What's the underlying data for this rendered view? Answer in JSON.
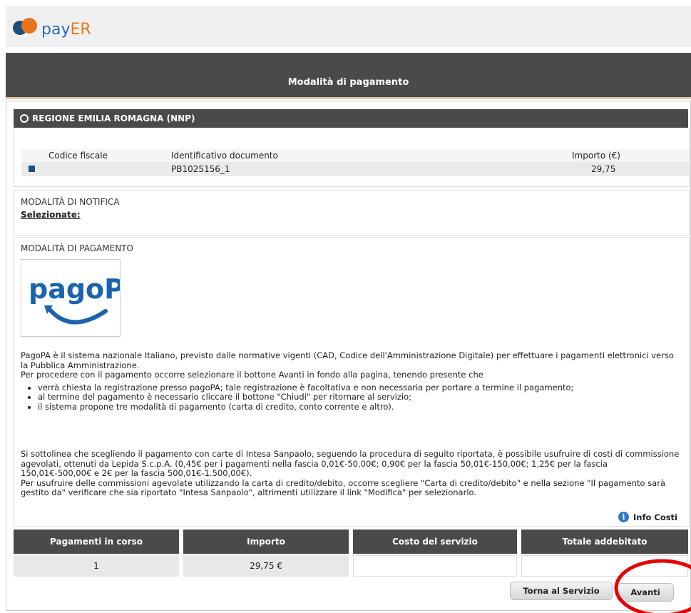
{
  "header": {
    "logo_text_1": "pay",
    "logo_text_2": "ER",
    "page_title": "Modalità di pagamento"
  },
  "ente": {
    "name": "REGIONE EMILIA ROMAGNA (NNP)"
  },
  "documents_table": {
    "columns": [
      "Codice fiscale",
      "Identificativo documento",
      "Importo (€)"
    ],
    "rows": [
      {
        "codice_fiscale": "",
        "identificativo": "PB1025156_1",
        "importo": "29,75"
      }
    ]
  },
  "notifica": {
    "heading": "MODALITÀ DI NOTIFICA",
    "selected_label": "Selezionate:"
  },
  "pagamento": {
    "heading": "MODALITÀ DI PAGAMENTO",
    "logo_text": "pagoPA",
    "intro_1": "PagoPA è il sistema nazionale Italiano, previsto dalle normative vigenti (CAD, Codice dell'Amministrazione Digitale) per effettuare i pagamenti elettronici verso la Pubblica Amministrazione.",
    "intro_2": "Per procedere con il pagamento occorre selezionare il bottone Avanti in fondo alla pagina, tenendo presente che",
    "bullets": [
      "verrà chiesta la registrazione presso pagoPA; tale registrazione è facoltativa e non necessaria per portare a termine il pagamento;",
      "al termine del pagamento è necessario cliccare il bottone \"Chiudi\" per ritornare al servizio;",
      "il sistema propone tre modalità di pagamento (carta di credito, conto corrente e altro)."
    ],
    "note_1": "Si sottolinea che scegliendo il pagamento con carte di Intesa Sanpaolo, seguendo la procedura di seguito riportata, è possibile usufruire di costi di commissione agevolati, ottenuti da Lepida S.c.p.A. (0,45€ per i pagamenti nella fascia 0,01€-50,00€; 0,90€ per la fascia 50,01€-150,00€; 1,25€ per la fascia 150,01€-500,00€ e 2€ per la fascia 500,01€-1.500,00€).",
    "note_2": "Per usufruire delle commissioni agevolate utilizzando la carta di credito/debito, occorre scegliere \"Carta di credito/debito\" e nella sezione \"Il pagamento sarà gestito da\" verificare che sia riportato \"Intesa Sanpaolo\", altrimenti utilizzare il link \"Modifica\" per selezionarlo.",
    "info_costi": "Info Costi"
  },
  "summary": {
    "headers": [
      "Pagamenti in corso",
      "Importo",
      "Costo del servizio",
      "Totale addebitato"
    ],
    "values": [
      "1",
      "29,75 €",
      "",
      ""
    ]
  },
  "actions": {
    "torna": "Torna al Servizio",
    "avanti": "Avanti"
  }
}
